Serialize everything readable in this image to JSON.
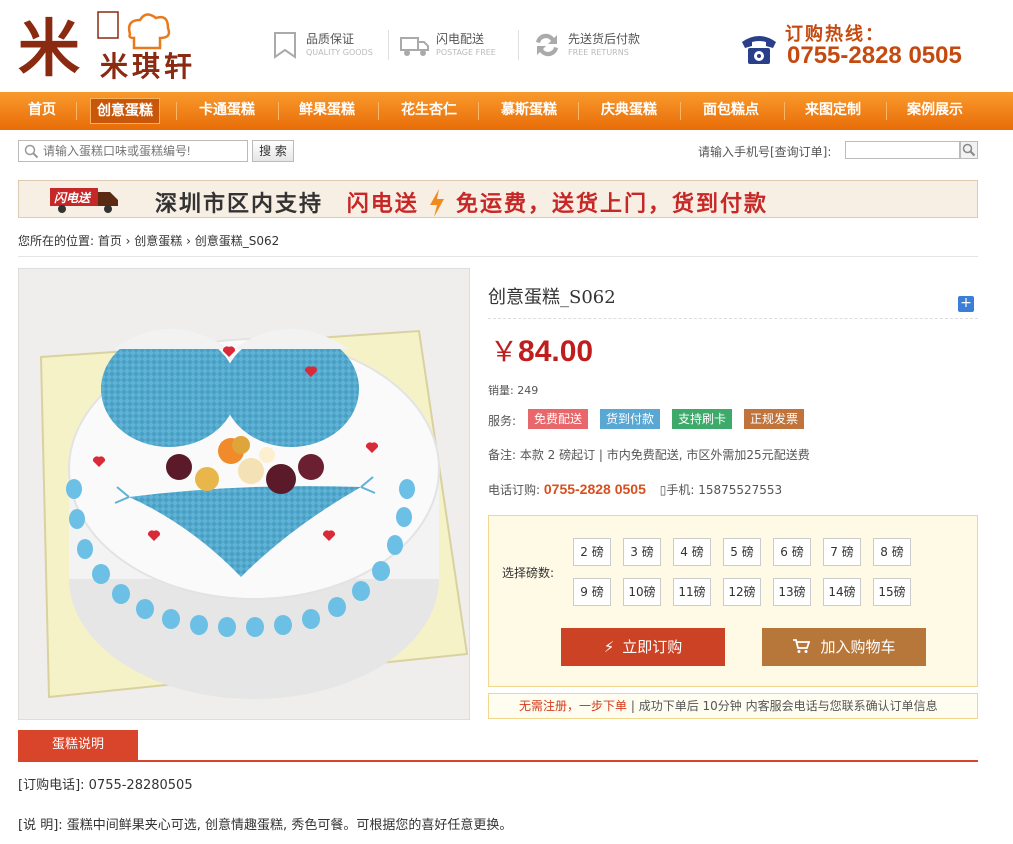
{
  "header": {
    "logo_text": "米琪轩",
    "features": [
      {
        "title": "品质保证",
        "sub": "QUALITY GOODS"
      },
      {
        "title": "闪电配送",
        "sub": "POSTAGE FREE"
      },
      {
        "title": "先送货后付款",
        "sub": "FREE RETURNS"
      }
    ],
    "hotline_label": "订购热线：",
    "hotline_number": "0755-2828 0505"
  },
  "nav": [
    "首页",
    "创意蛋糕",
    "卡通蛋糕",
    "鲜果蛋糕",
    "花生杏仁",
    "慕斯蛋糕",
    "庆典蛋糕",
    "面包糕点",
    "来图定制",
    "案例展示"
  ],
  "search": {
    "placeholder": "请输入蛋糕口味或蛋糕编号!",
    "button": "搜 索",
    "order_label": "请输入手机号[查询订单]:"
  },
  "banner": {
    "badge": "闪电送",
    "text_a": "深圳市区内支持",
    "text_b": "闪电送",
    "text_c": "免运费，送货上门，货到付款"
  },
  "breadcrumb": "您所在的位置: 首页 › 创意蛋糕 › 创意蛋糕_S062",
  "product": {
    "title": "创意蛋糕_S062",
    "currency": "￥",
    "price": "84.00",
    "sales": "销量: 249",
    "service_label": "服务:",
    "tags": [
      {
        "label": "免费配送",
        "color": "#e8676a"
      },
      {
        "label": "货到付款",
        "color": "#5aa7d4"
      },
      {
        "label": "支持刷卡",
        "color": "#3daa6a"
      },
      {
        "label": "正规发票",
        "color": "#c0733a"
      }
    ],
    "note": "备注: 本款 2 磅起订 | 市内免费配送, 市区外需加25元配送费",
    "tel_label": "电话订购:",
    "tel_number": "0755-2828 0505",
    "mobile_label": "手机:",
    "mobile_number": "15875527553",
    "weight_label": "选择磅数:",
    "weights": [
      "2 磅",
      "3 磅",
      "4 磅",
      "5 磅",
      "6 磅",
      "7 磅",
      "8 磅",
      "9 磅",
      "10磅",
      "11磅",
      "12磅",
      "13磅",
      "14磅",
      "15磅"
    ],
    "buy_now": "立即订购",
    "add_cart": "加入购物车",
    "tip_red": "无需注册，一步下单",
    "tip_rest": "| 成功下单后 10分钟 内客服会电话与您联系确认订单信息"
  },
  "description": {
    "tab": "蛋糕说明",
    "line1": "[订购电话]: 0755-28280505",
    "line2": "[说 明]: 蛋糕中间鲜果夹心可选, 创意情趣蛋糕, 秀色可餐。可根据您的喜好任意更换。"
  }
}
